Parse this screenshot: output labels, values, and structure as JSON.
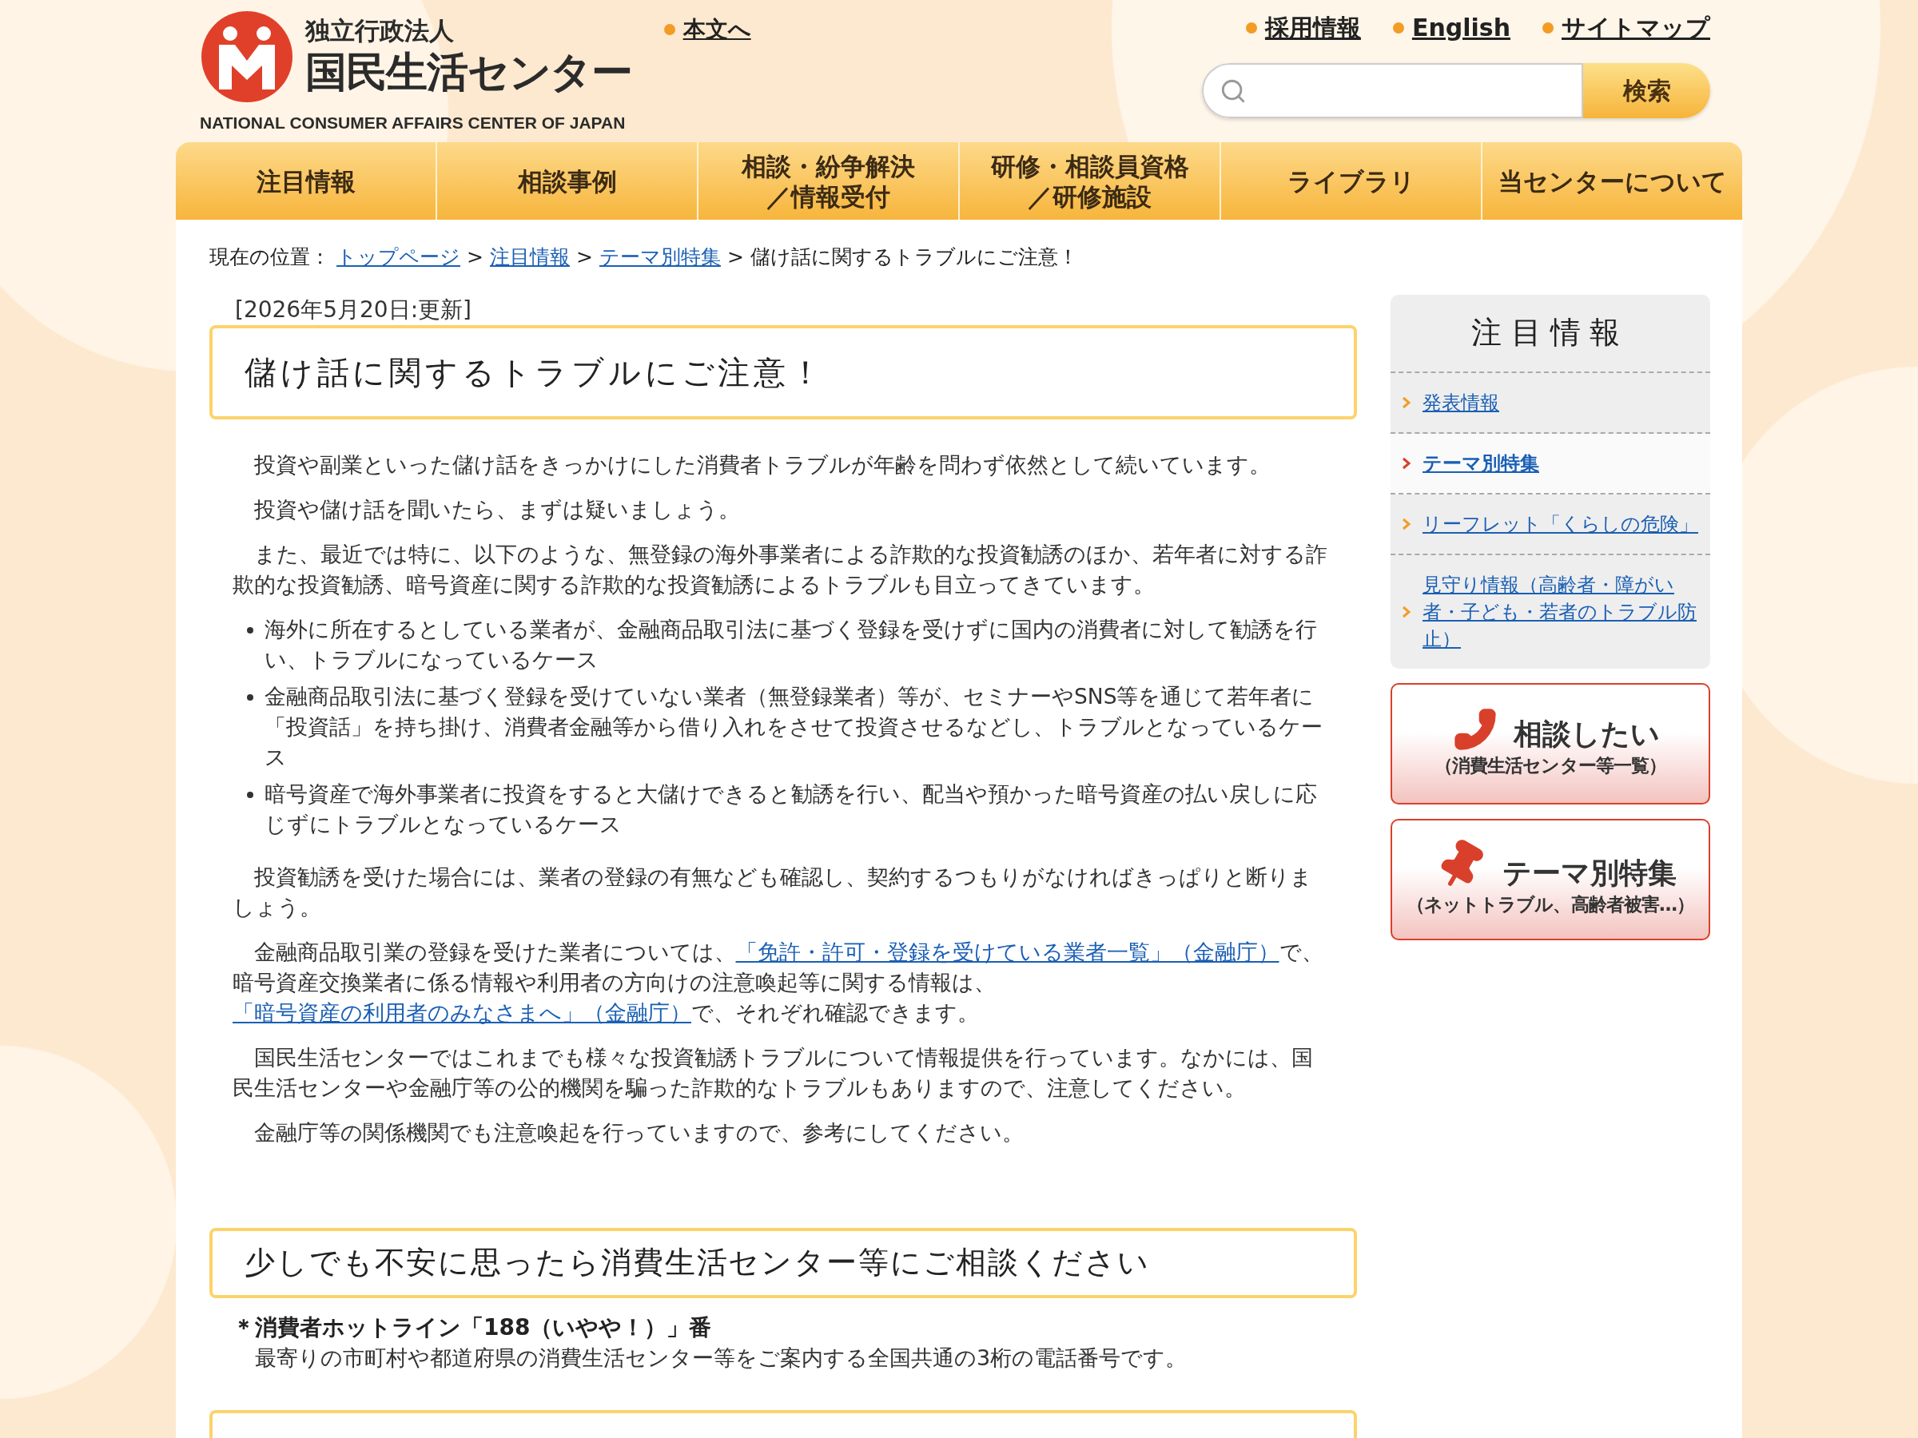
{
  "header": {
    "logo": {
      "org_type": "独立行政法人",
      "name": "国民生活センター",
      "english": "NATIONAL CONSUMER AFFAIRS CENTER OF JAPAN"
    },
    "skip_link": "本文へ",
    "utility_links": [
      "採用情報",
      "English",
      "サイトマップ"
    ],
    "search": {
      "button": "検索"
    }
  },
  "nav": [
    {
      "lines": [
        "注目情報"
      ]
    },
    {
      "lines": [
        "相談事例"
      ]
    },
    {
      "lines": [
        "相談・紛争解決",
        "／情報受付"
      ]
    },
    {
      "lines": [
        "研修・相談員資格",
        "／研修施設"
      ]
    },
    {
      "lines": [
        "ライブラリ"
      ]
    },
    {
      "lines": [
        "当センターについて"
      ]
    }
  ],
  "breadcrumb": {
    "label": "現在の位置：",
    "separator": ">",
    "links": [
      "トップページ",
      "注目情報",
      "テーマ別特集"
    ],
    "current": "儲け話に関するトラブルにご注意！"
  },
  "article": {
    "updated": "[2026年5月20日:更新]",
    "title": "儲け話に関するトラブルにご注意！",
    "content": [
      {
        "kind": "paragraph",
        "segments": [
          {
            "text": "投資や副業といった儲け話をきっかけにした消費者トラブルが年齢を問わず依然として続いています。",
            "link": false
          }
        ]
      },
      {
        "kind": "paragraph",
        "segments": [
          {
            "text": "投資や儲け話を聞いたら、まずは疑いましょう。",
            "link": false
          }
        ]
      },
      {
        "kind": "paragraph",
        "segments": [
          {
            "text": "また、最近では特に、以下のような、無登録の海外事業者による詐欺的な投資勧誘のほか、若年者に対する詐欺的な投資勧誘、暗号資産に関する詐欺的な投資勧誘によるトラブルも目立ってきています。",
            "link": false
          }
        ]
      },
      {
        "kind": "bullets",
        "items": [
          "海外に所在するとしている業者が、金融商品取引法に基づく登録を受けずに国内の消費者に対して勧誘を行い、トラブルになっているケース",
          "金融商品取引法に基づく登録を受けていない業者（無登録業者）等が、セミナーやSNS等を通じて若年者に「投資話」を持ち掛け、消費者金融等から借り入れをさせて投資させるなどし、トラブルとなっているケース",
          "暗号資産で海外事業者に投資をすると大儲けできると勧誘を行い、配当や預かった暗号資産の払い戻しに応じずにトラブルとなっているケース"
        ]
      },
      {
        "kind": "paragraph",
        "segments": [
          {
            "text": "投資勧誘を受けた場合には、業者の登録の有無なども確認し、契約するつもりがなければきっぱりと断りましょう。",
            "link": false
          }
        ]
      },
      {
        "kind": "paragraph",
        "segments": [
          {
            "text": "金融商品取引業の登録を受けた業者については、",
            "link": false
          },
          {
            "text": "「免許・許可・登録を受けている業者一覧」（金融庁）",
            "link": true
          },
          {
            "text": "で、暗号資産交換業者に係る情報や利用者の方向けの注意喚起等に関する情報は、",
            "link": false
          },
          {
            "text": "「暗号資産の利用者のみなさまへ」（金融庁）",
            "link": true
          },
          {
            "text": "で、それぞれ確認できます。",
            "link": false
          }
        ]
      },
      {
        "kind": "paragraph",
        "segments": [
          {
            "text": "国民生活センターではこれまでも様々な投資勧誘トラブルについて情報提供を行っています。なかには、国民生活センターや金融庁等の公的機関を騙った詐欺的なトラブルもありますので、注意してください。",
            "link": false
          }
        ]
      },
      {
        "kind": "paragraph",
        "segments": [
          {
            "text": "金融庁等の関係機関でも注意喚起を行っていますので、参考にしてください。",
            "link": false
          }
        ]
      }
    ]
  },
  "consult_section": {
    "title": "少しでも不安に思ったら消費生活センター等にご相談ください",
    "hotline_title": "＊消費者ホットライン「188（いやや！）」番",
    "hotline_text": "最寄りの市町村や都道府県の消費生活センター等をご案内する全国共通の3桁の電話番号です。"
  },
  "sidebar": {
    "heading": "注目情報",
    "items": [
      {
        "label": "発表情報",
        "selected": false
      },
      {
        "label": "テーマ別特集",
        "selected": true
      },
      {
        "label": "リーフレット「くらしの危険」",
        "selected": false
      },
      {
        "label": "見守り情報（高齢者・障がい者・子ども・若者のトラブル防止）",
        "selected": false
      }
    ],
    "banners": [
      {
        "kind": "phone",
        "title": "相談したい",
        "subtitle": "（消費生活センター等一覧）"
      },
      {
        "kind": "pin",
        "title": "テーマ別特集",
        "subtitle": "（ネットトラブル、高齢者被害…）"
      }
    ]
  }
}
